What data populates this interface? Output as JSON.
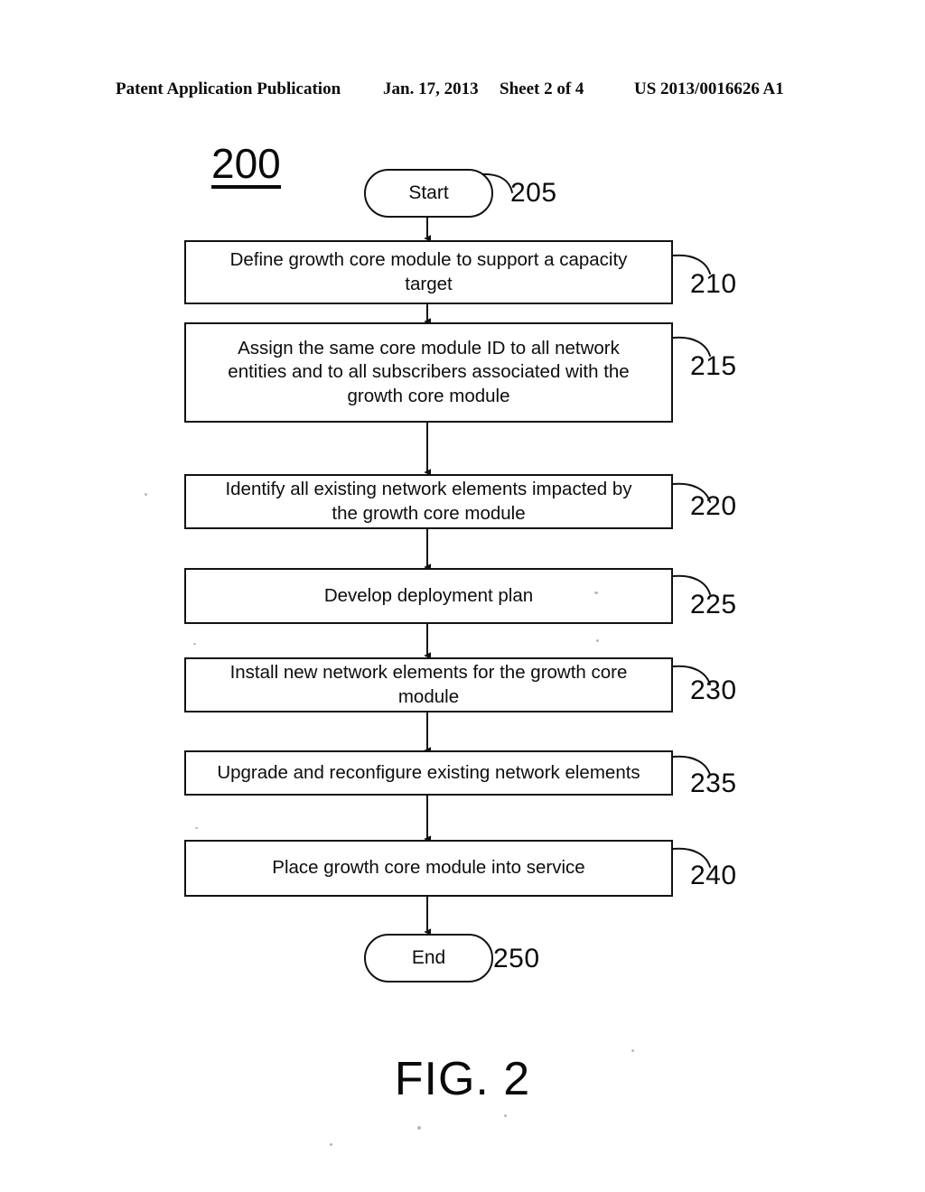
{
  "header": {
    "publication": "Patent Application Publication",
    "date": "Jan. 17, 2013",
    "sheet": "Sheet 2 of 4",
    "patent_number": "US 2013/0016626 A1"
  },
  "figure": {
    "label": "200",
    "caption": "FIG. 2",
    "start_terminal": {
      "text": "Start",
      "ref": "205"
    },
    "end_terminal": {
      "text": "End",
      "ref": "250"
    },
    "steps": [
      {
        "ref": "210",
        "lines": [
          "Define growth core module to support a capacity",
          "target"
        ],
        "text": "Define growth core module to support a capacity target"
      },
      {
        "ref": "215",
        "lines": [
          "Assign the same core module ID to all network",
          "entities and to all subscribers associated with the",
          "growth core module"
        ],
        "text": "Assign the same core module ID to all network entities and to all subscribers associated with the growth core module"
      },
      {
        "ref": "220",
        "lines": [
          "Identify all existing network elements impacted by",
          "the growth core module"
        ],
        "text": "Identify all existing network elements impacted by the growth core module"
      },
      {
        "ref": "225",
        "lines": [
          "Develop deployment plan"
        ],
        "text": "Develop deployment plan"
      },
      {
        "ref": "230",
        "lines": [
          "Install new network elements for the growth core",
          "module"
        ],
        "text": "Install new network elements for the growth core module"
      },
      {
        "ref": "235",
        "lines": [
          "Upgrade and reconfigure existing network elements"
        ],
        "text": "Upgrade and reconfigure existing network elements"
      },
      {
        "ref": "240",
        "lines": [
          "Place growth core module into service"
        ],
        "text": "Place growth core module into service"
      }
    ]
  },
  "colors": {
    "ink": "#121212",
    "paper": "#ffffff"
  }
}
